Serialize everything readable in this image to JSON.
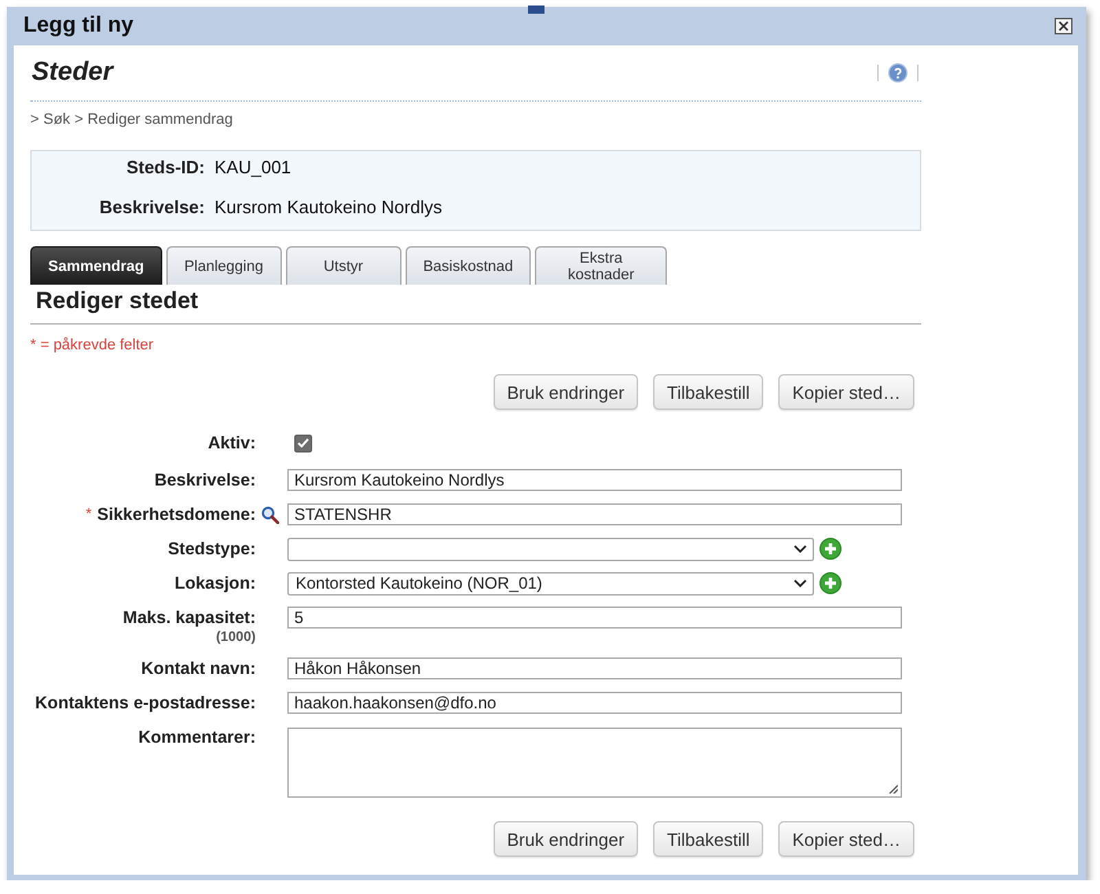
{
  "window": {
    "title": "Legg til ny"
  },
  "page": {
    "title": "Steder",
    "breadcrumb": "> Søk > Rediger sammendrag"
  },
  "summary": [
    {
      "label": "Steds-ID:",
      "value": "KAU_001"
    },
    {
      "label": "Beskrivelse:",
      "value": "Kursrom Kautokeino Nordlys"
    }
  ],
  "tabs": [
    {
      "label": "Sammendrag",
      "selected": true
    },
    {
      "label": "Planlegging",
      "selected": false
    },
    {
      "label": "Utstyr",
      "selected": false
    },
    {
      "label": "Basiskostnad",
      "selected": false
    },
    {
      "label": "Ekstra kostnader",
      "selected": false
    }
  ],
  "form": {
    "heading": "Rediger stedet",
    "required_note": "* = påkrevde felter",
    "buttons_top": [
      "Bruk endringer",
      "Tilbakestill",
      "Kopier sted…"
    ],
    "fields": [
      {
        "kind": "checkbox",
        "label": "Aktiv:",
        "checked": true
      },
      {
        "kind": "text",
        "label": "Beskrivelse:",
        "value": "Kursrom Kautokeino Nordlys"
      },
      {
        "kind": "lookup",
        "label": "Sikkerhetsdomene:",
        "marker": "*",
        "value": "STATENSHR"
      },
      {
        "kind": "select",
        "label": "Stedstype:"
      },
      {
        "kind": "select",
        "label": "Lokasjon:",
        "value": "Kontorsted Kautokeino (NOR_01)"
      },
      {
        "kind": "text",
        "label": "Maks. kapasitet:",
        "hint": "(1000)",
        "value": "5"
      },
      {
        "kind": "text",
        "label": "Kontakt navn:",
        "value": "Håkon Håkonsen"
      },
      {
        "kind": "text",
        "label": "Kontaktens e-postadresse:",
        "value": "haakon.haakonsen@dfo.no"
      },
      {
        "kind": "textarea",
        "label": "Kommentarer:"
      }
    ],
    "buttons_bottom": [
      "Bruk endringer",
      "Tilbakestill",
      "Kopier sted…"
    ]
  }
}
